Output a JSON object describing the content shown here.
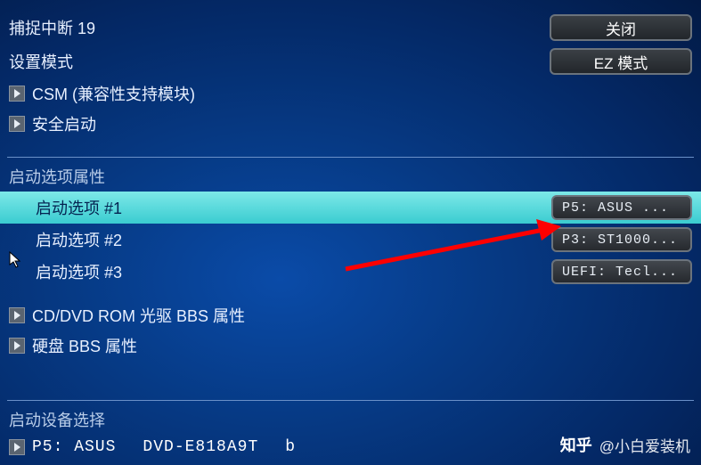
{
  "header": {
    "line1": "捕捉中断 19",
    "line2": "设置模式",
    "close_btn": "关闭",
    "ez_mode_btn": "EZ 模式"
  },
  "top_items": {
    "csm": "CSM (兼容性支持模块)",
    "secure_boot": "安全启动"
  },
  "boot_props": {
    "section_title": "启动选项属性",
    "options": [
      {
        "label": "启动选项 #1",
        "value": "P5: ASUS  ..."
      },
      {
        "label": "启动选项 #2",
        "value": "P3: ST1000..."
      },
      {
        "label": "启动选项 #3",
        "value": "UEFI: Tecl..."
      }
    ]
  },
  "bbs": {
    "cd_dvd": "CD/DVD ROM 光驱 BBS 属性",
    "hdd": "硬盘 BBS 属性"
  },
  "boot_device": {
    "section_title": "启动设备选择",
    "device_prefix": "P5: ASUS",
    "device_model": "DVD-E818A9T",
    "device_suffix": "b"
  },
  "watermark": {
    "logo": "知乎",
    "text": "@小白爱装机"
  }
}
